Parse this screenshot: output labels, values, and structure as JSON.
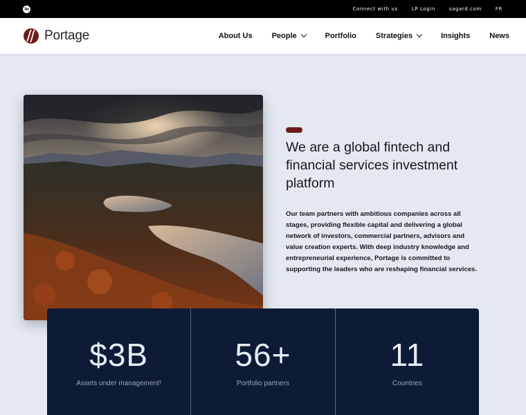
{
  "topbar": {
    "links": [
      "Connect with us",
      "LP Login",
      "sagard.com",
      "FR"
    ]
  },
  "brand": {
    "name": "Portage",
    "accent_color": "#6c1a1c"
  },
  "nav": {
    "items": [
      {
        "label": "About Us",
        "dropdown": false
      },
      {
        "label": "People",
        "dropdown": true
      },
      {
        "label": "Portfolio",
        "dropdown": false
      },
      {
        "label": "Strategies",
        "dropdown": true
      },
      {
        "label": "Insights",
        "dropdown": false
      },
      {
        "label": "News",
        "dropdown": false
      }
    ]
  },
  "hero": {
    "headline": "We are a global fintech and financial services investment platform",
    "body": "Our team partners with ambitious companies across all stages, providing flexible capital and delivering a global network of investors, commercial partners, advisors and value creation experts. With deep industry knowledge and entrepreneurial experience, Portage is committed to supporting the leaders who are reshaping financial services."
  },
  "stats": [
    {
      "value": "$3B",
      "label": "Assets under management¹"
    },
    {
      "value": "56+",
      "label": "Portfolio partners"
    },
    {
      "value": "11",
      "label": "Countries"
    }
  ],
  "colors": {
    "page_bg": "#e3e8f1",
    "stats_bg": "#0d1b36",
    "topbar_bg": "#000000"
  }
}
